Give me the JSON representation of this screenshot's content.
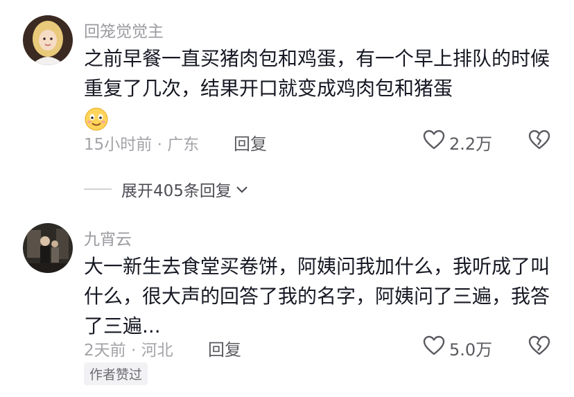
{
  "comments": [
    {
      "username": "回笼觉觉主",
      "text": "之前早餐一直买猪肉包和鸡蛋，有一个早上排队的时候重复了几次，结果开口就变成鸡肉包和猪蛋",
      "time_location": "15小时前 · 广东",
      "reply_label": "回复",
      "likes": "2.2万",
      "emoji_icon": "smiling-face-emoji",
      "expand_label": "展开405条回复"
    },
    {
      "username": "九宵云",
      "text": "大一新生去食堂买卷饼，阿姨问我加什么，我听成了叫什么，很大声的回答了我的名字，阿姨问了三遍，我答了三遍...",
      "time_location": "2天前 · 河北",
      "reply_label": "回复",
      "likes": "5.0万",
      "author_badge": "作者赞过"
    }
  ],
  "icons": {
    "like": "heart-outline-icon",
    "dislike": "broken-heart-icon",
    "expand": "chevron-down-icon"
  },
  "colors": {
    "text_primary": "#161823",
    "text_secondary": "#9a9aa0",
    "badge_bg": "#f2f2f4"
  }
}
